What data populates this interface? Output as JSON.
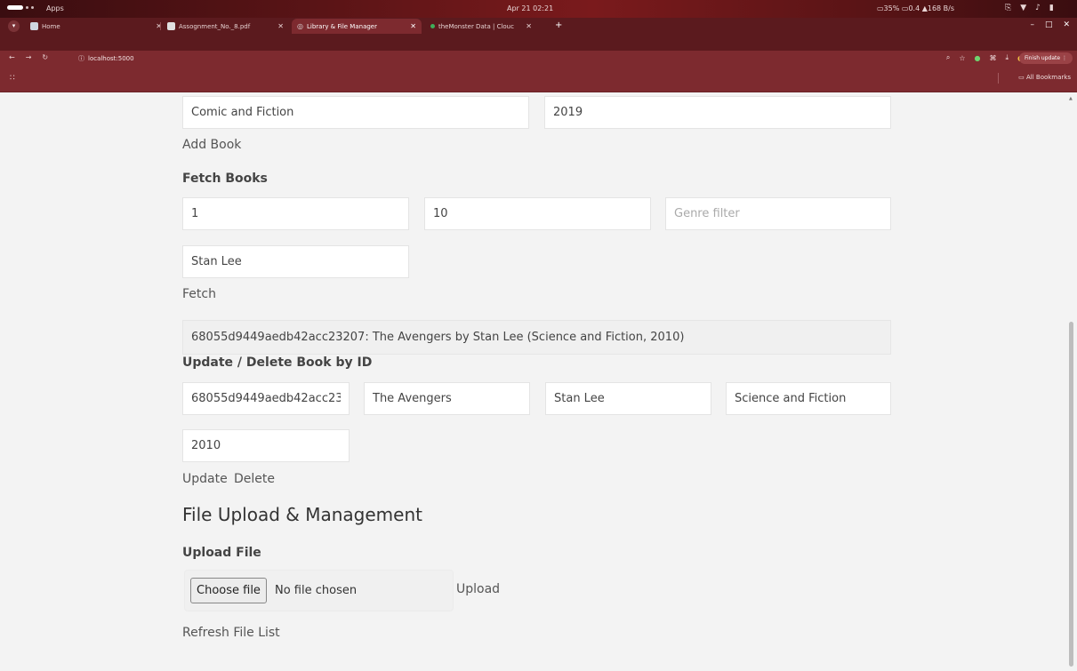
{
  "os": {
    "apps": "Apps",
    "clock": "Apr 21 02:21",
    "stats": "▭35%  ▭0.4  ▲168 B/s"
  },
  "browser": {
    "tabs": [
      {
        "label": "Home",
        "active": false
      },
      {
        "label": "Assognment_No._8.pdf",
        "active": false
      },
      {
        "label": "Library & File Manager",
        "active": true
      },
      {
        "label": "theMonster Data | Clouc",
        "active": false
      }
    ],
    "url": "localhost:5000",
    "finish_update": "Finish update",
    "all_bookmarks": "All Bookmarks"
  },
  "add_book": {
    "genre_value": "Comic and Fiction",
    "year_value": "2019",
    "add_label": "Add Book"
  },
  "fetch": {
    "heading": "Fetch Books",
    "page_value": "1",
    "limit_value": "10",
    "genre_placeholder": "Genre filter",
    "author_value": "Stan Lee",
    "fetch_label": "Fetch",
    "result": "68055d9449aedb42acc23207: The Avengers by Stan Lee (Science and Fiction, 2010)"
  },
  "update": {
    "heading": "Update / Delete Book by ID",
    "id_value": "68055d9449aedb42acc23",
    "title_value": "The Avengers",
    "author_value": "Stan Lee",
    "genre_value": "Science and Fiction",
    "year_value": "2010",
    "update_label": "Update",
    "delete_label": "Delete"
  },
  "files": {
    "heading": "File Upload & Management",
    "upload_heading": "Upload File",
    "choose_label": "Choose file",
    "no_file": "No file chosen",
    "upload_label": "Upload",
    "refresh_label": "Refresh File List"
  }
}
